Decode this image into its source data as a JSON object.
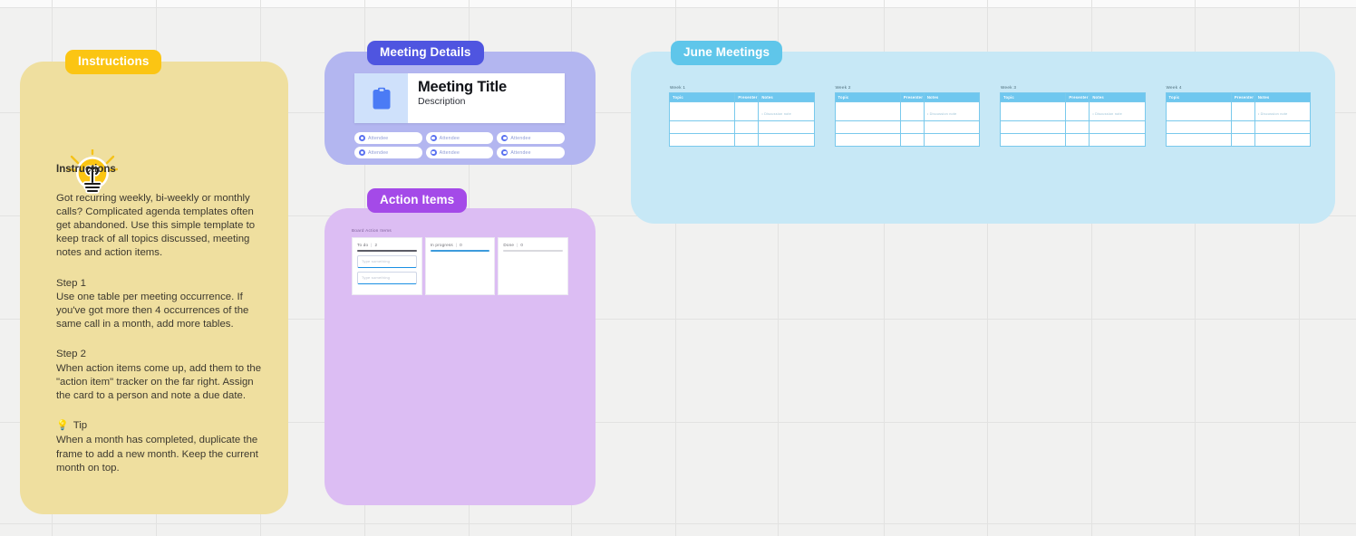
{
  "canvas": {
    "background_color": "#f1f1f0",
    "grid_color": "#e2e2e1"
  },
  "frames": {
    "instructions": {
      "label": "Instructions",
      "label_color": "#fbc513",
      "body_color": "#efdf9f",
      "icon": "lightbulb-icon",
      "heading": "Instructions",
      "intro": "Got recurring weekly, bi-weekly or monthly calls? Complicated agenda templates often get abandoned. Use this simple template to keep track of all topics discussed, meeting notes and action items.",
      "step1_title": "Step 1",
      "step1_body": "Use one table per meeting occurrence. If you've got more then 4 occurrences of the same call in a month, add more tables.",
      "step2_title": "Step 2",
      "step2_body": "When action items come up, add them to the \"action item\" tracker on the far right. Assign the card to a person and note a due date.",
      "tip_icon": "💡",
      "tip_title": "Tip",
      "tip_body": "When a month has completed, duplicate the frame to add a new month. Keep the current month on top."
    },
    "meeting_details": {
      "label": "Meeting Details",
      "label_color": "#4f55e0",
      "body_color": "#b3b6f0",
      "card": {
        "icon": "clipboard-icon",
        "icon_color": "#4b7bf5",
        "icon_bg": "#cfe1fb",
        "title": "Meeting Title",
        "description": "Description"
      },
      "attendees": [
        {
          "label": "Attendee"
        },
        {
          "label": "Attendee"
        },
        {
          "label": "Attendee"
        },
        {
          "label": "Attendee"
        },
        {
          "label": "Attendee"
        },
        {
          "label": "Attendee"
        }
      ]
    },
    "action_items": {
      "label": "Action Items",
      "label_color": "#a44ae8",
      "body_color": "#dcbdf3",
      "board_title": "Board Action Items",
      "columns": [
        {
          "name": "To do",
          "separator": "|",
          "count": "2",
          "bar_color": "#5c5c66",
          "cards": [
            {
              "text": "Type something"
            },
            {
              "text": "Type something"
            }
          ]
        },
        {
          "name": "In progress",
          "separator": "|",
          "count": "0",
          "bar_color": "#3d9bdc",
          "cards": []
        },
        {
          "name": "Done",
          "separator": "|",
          "count": "0",
          "bar_color": "#d9d9de",
          "cards": []
        }
      ]
    },
    "june_meetings": {
      "label": "June Meetings",
      "label_color": "#5fc6ea",
      "body_color": "#c7e8f6",
      "table_header_color": "#6fc7ef",
      "columns": [
        "Topic",
        "Presenter",
        "Notes"
      ],
      "weeks": [
        {
          "label": "Week 1",
          "rows": [
            {
              "topic": "",
              "presenter": "",
              "notes": "Discussion note"
            },
            {
              "topic": "",
              "presenter": "",
              "notes": ""
            },
            {
              "topic": "",
              "presenter": "",
              "notes": ""
            }
          ]
        },
        {
          "label": "Week 2",
          "rows": [
            {
              "topic": "",
              "presenter": "",
              "notes": "Discussion note"
            },
            {
              "topic": "",
              "presenter": "",
              "notes": ""
            },
            {
              "topic": "",
              "presenter": "",
              "notes": ""
            }
          ]
        },
        {
          "label": "Week 3",
          "rows": [
            {
              "topic": "",
              "presenter": "",
              "notes": "Discussion note"
            },
            {
              "topic": "",
              "presenter": "",
              "notes": ""
            },
            {
              "topic": "",
              "presenter": "",
              "notes": ""
            }
          ]
        },
        {
          "label": "Week 4",
          "rows": [
            {
              "topic": "",
              "presenter": "",
              "notes": "Discussion note"
            },
            {
              "topic": "",
              "presenter": "",
              "notes": ""
            },
            {
              "topic": "",
              "presenter": "",
              "notes": ""
            }
          ]
        }
      ]
    }
  }
}
